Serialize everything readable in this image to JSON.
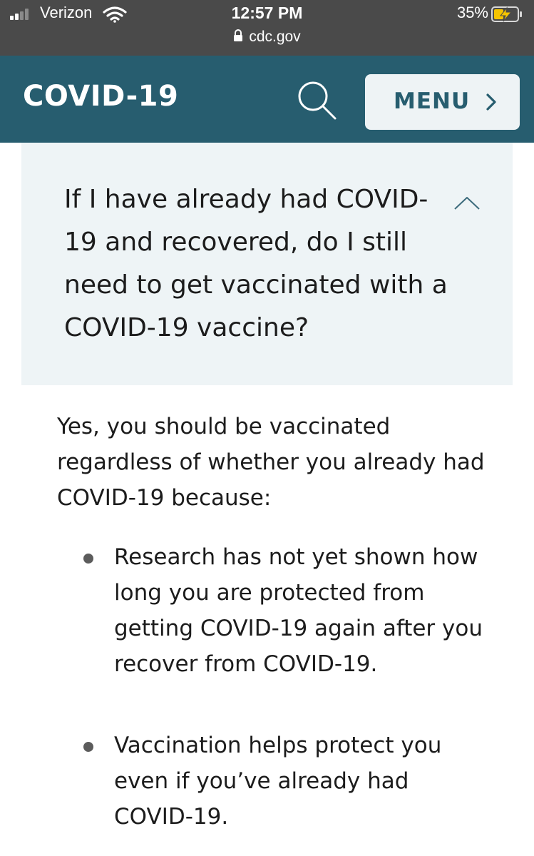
{
  "status_bar": {
    "carrier": "Verizon",
    "time": "12:57 PM",
    "url": "cdc.gov",
    "battery_percent": "35%",
    "signal_bars": 2,
    "icons": [
      "signal-icon",
      "wifi-icon",
      "lock-icon",
      "battery-charging-icon"
    ]
  },
  "header": {
    "title": "COVID-19",
    "search_icon": "search-icon",
    "menu_label": "MENU",
    "menu_icon": "chevron-right-icon",
    "background_color": "#275d6f",
    "accent_color": "#eef3f5"
  },
  "faq": {
    "question": "If I have already had COVID-19 and recovered, do I still need to get vaccinated with a COVID-19 vaccine?",
    "expanded": true,
    "toggle_icon": "chevron-up-icon",
    "answer_intro": "Yes, you should be vaccinated regardless of whether you already had COVID-19 because:",
    "bullets": [
      "Research has not yet shown how long you are protected from getting COVID-19 again after you recover from COVID-19.",
      "Vaccination helps protect you even if you’ve already had COVID-19."
    ]
  }
}
